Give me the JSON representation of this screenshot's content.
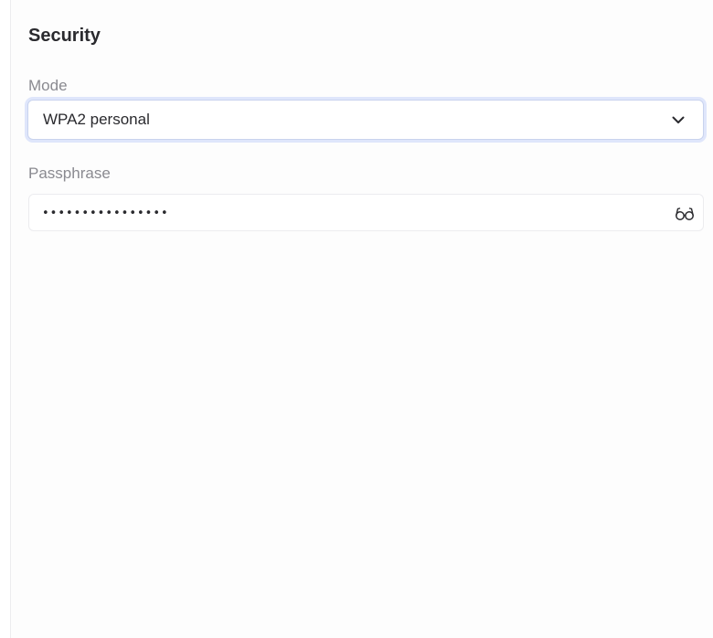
{
  "security": {
    "title": "Security",
    "mode": {
      "label": "Mode",
      "selected": "WPA2 personal",
      "icon": "chevron-down-icon"
    },
    "passphrase": {
      "label": "Passphrase",
      "value": "••••••••••••••••",
      "toggle_icon": "glasses-icon"
    }
  },
  "colors": {
    "focus_ring": "#dfe6fb",
    "label": "#8a8a90",
    "text": "#2a2a2e"
  }
}
